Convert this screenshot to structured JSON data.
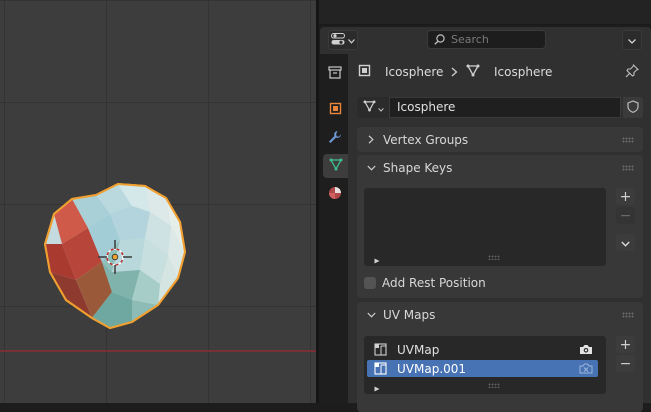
{
  "header": {
    "search_placeholder": "Search"
  },
  "breadcrumb": {
    "object_name": "Icosphere",
    "mesh_name": "Icosphere"
  },
  "mesh_datablock": {
    "name": "Icosphere"
  },
  "panels": {
    "vertex_groups": {
      "title": "Vertex Groups",
      "expanded": false
    },
    "shape_keys": {
      "title": "Shape Keys",
      "expanded": true,
      "add_rest_position_label": "Add Rest Position",
      "add_rest_position_checked": false
    },
    "uv_maps": {
      "title": "UV Maps",
      "expanded": true,
      "items": [
        {
          "name": "UVMap",
          "selected": false,
          "active_render": true
        },
        {
          "name": "UVMap.001",
          "selected": true,
          "active_render": false
        }
      ]
    }
  },
  "colors": {
    "accent_selection": "#4772b3",
    "object_outline": "#f0a030",
    "x_axis": "#8a2d35",
    "active_tab_mesh": "#3fbf8f",
    "object_tab": "#e8853a",
    "modifier_tab": "#6f9ad8",
    "material_tab": "#d06060"
  },
  "icons": {
    "editor_type": "properties-editor-icon",
    "search": "search-icon",
    "pin": "pin-icon",
    "object": "object-icon",
    "mesh": "mesh-data-icon"
  }
}
